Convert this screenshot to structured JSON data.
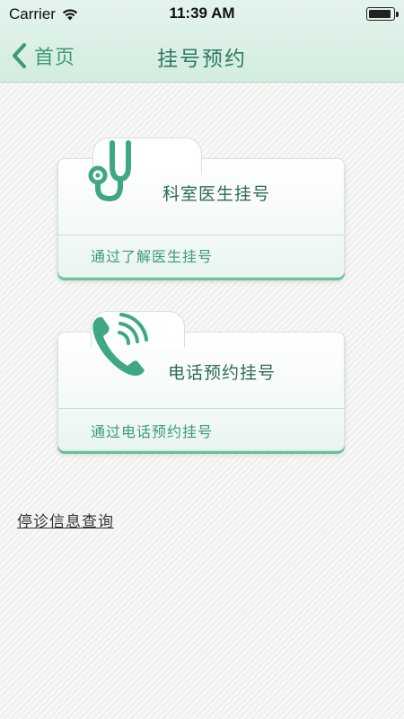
{
  "status_bar": {
    "carrier": "Carrier",
    "time": "11:39 AM",
    "wifi_icon": "wifi-icon",
    "battery_icon": "battery-icon"
  },
  "nav": {
    "back_label": "首页",
    "back_icon": "chevron-left-icon",
    "title": "挂号预约"
  },
  "cards": [
    {
      "title": "科室医生挂号",
      "subtitle": "通过了解医生挂号",
      "icon": "stethoscope-icon"
    },
    {
      "title": "电话预约挂号",
      "subtitle": "通过电话预约挂号",
      "icon": "phone-icon"
    }
  ],
  "suspension_link": "停诊信息查询",
  "colors": {
    "accent": "#3d9a77",
    "accent_dark": "#2e6b54",
    "card_shadow": "#64c39a",
    "background": "#f3f4f2"
  }
}
